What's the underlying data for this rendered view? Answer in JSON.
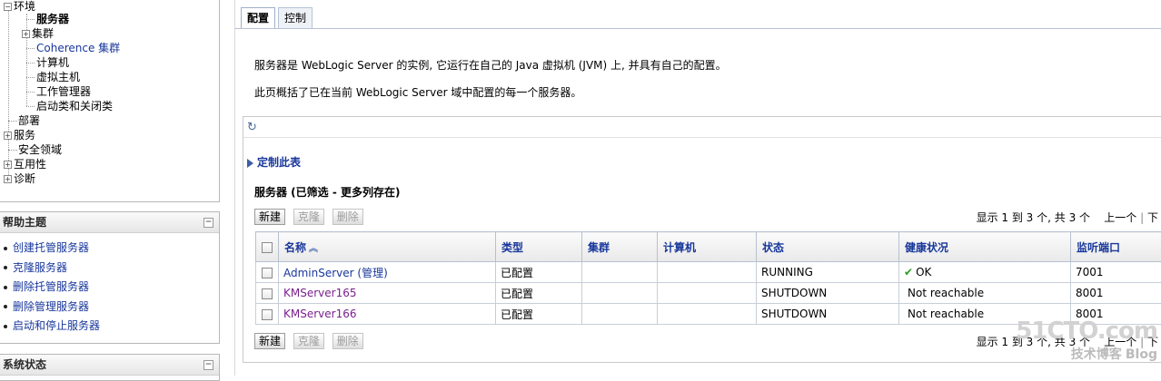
{
  "tree": {
    "root": "环境",
    "children": [
      "服务器",
      "集群",
      "Coherence 集群",
      "计算机",
      "虚拟主机",
      "工作管理器",
      "启动类和关闭类"
    ],
    "top": [
      "部署",
      "服务",
      "安全领域",
      "互用性",
      "诊断"
    ]
  },
  "help": {
    "title": "帮助主题",
    "items": [
      "创建托管服务器",
      "克隆服务器",
      "删除托管服务器",
      "删除管理服务器",
      "启动和停止服务器"
    ]
  },
  "status": {
    "title": "系统状态"
  },
  "tabs": [
    "配置",
    "控制"
  ],
  "description": {
    "line1": "服务器是 WebLogic Server 的实例, 它运行在自己的 Java 虚拟机 (JVM) 上, 并具有自己的配置。",
    "line2": "此页概括了已在当前 WebLogic Server 域中配置的每一个服务器。"
  },
  "customize_label": "定制此表",
  "table_title": "服务器 (已筛选 - 更多列存在)",
  "buttons": {
    "new": "新建",
    "clone": "克隆",
    "delete": "删除"
  },
  "pager": {
    "summary": "显示 1 到 3 个, 共 3 个",
    "prev": "上一个",
    "next": "下"
  },
  "columns": [
    "名称",
    "类型",
    "集群",
    "计算机",
    "状态",
    "健康状况",
    "监听端口"
  ],
  "rows": [
    {
      "name": "AdminServer (管理)",
      "type": "已配置",
      "cluster": "",
      "machine": "",
      "state": "RUNNING",
      "health": "OK",
      "port": "7001"
    },
    {
      "name": "KMServer165",
      "type": "已配置",
      "cluster": "",
      "machine": "",
      "state": "SHUTDOWN",
      "health": "Not reachable",
      "port": "8001"
    },
    {
      "name": "KMServer166",
      "type": "已配置",
      "cluster": "",
      "machine": "",
      "state": "SHUTDOWN",
      "health": "Not reachable",
      "port": "8001"
    }
  ],
  "watermark": {
    "line1": "51CTO.com",
    "line2": "技术博客",
    "line3": "Blog"
  }
}
